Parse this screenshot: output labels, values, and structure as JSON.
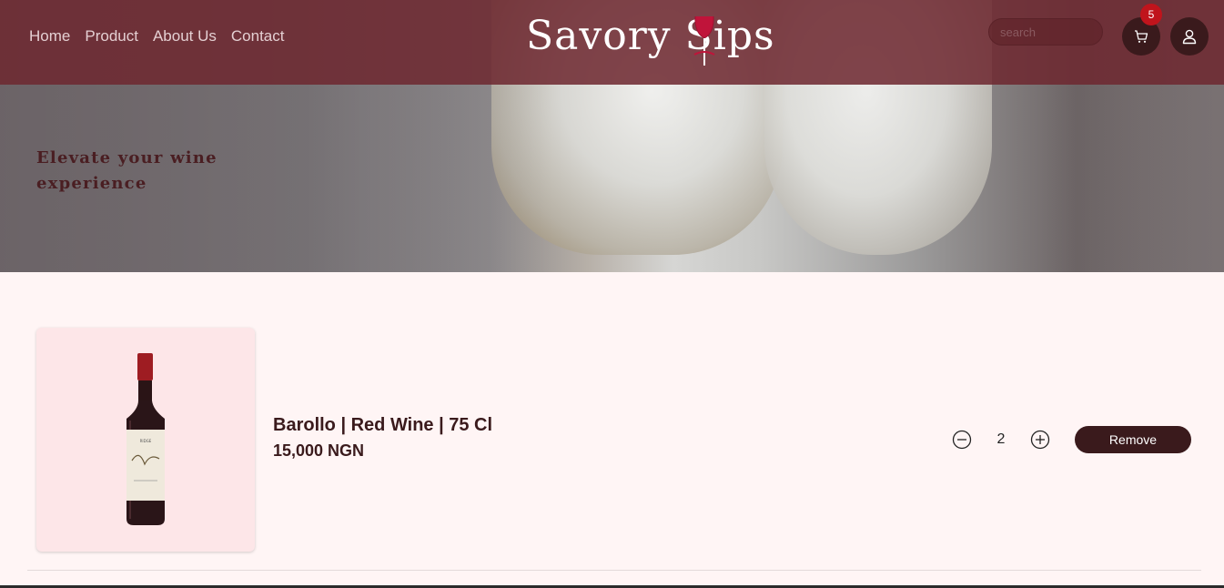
{
  "nav": {
    "links": [
      "Home",
      "Product",
      "About Us",
      "Contact"
    ],
    "logo": "Savory Sips",
    "search_placeholder": "search",
    "cart_count": "5",
    "icons": {
      "cart": "cart-icon",
      "user": "user-icon",
      "logo_glass": "wine-glass-icon"
    }
  },
  "hero": {
    "tagline": "Elevate your wine experience"
  },
  "cart": {
    "items": [
      {
        "name": "Barollo | Red Wine | 75 Cl",
        "price": "15,000 NGN",
        "quantity": "2",
        "remove_label": "Remove"
      }
    ]
  },
  "colors": {
    "navbar": "#6e2830",
    "primary_dark": "#3a1a1c",
    "badge": "#c0141c",
    "page_bg": "#fff5f5",
    "card_bg": "#fde6e8"
  }
}
